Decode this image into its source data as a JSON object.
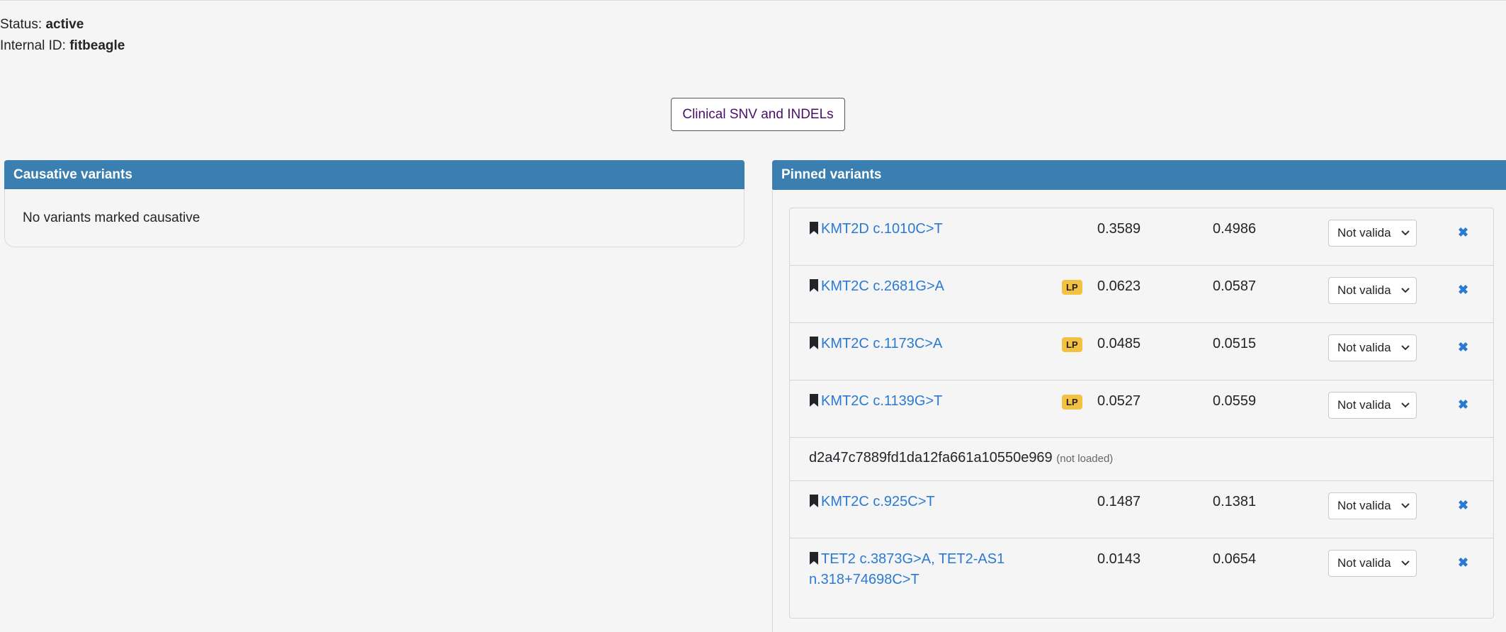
{
  "case_info": {
    "status_label": "Status:",
    "status_value": "active",
    "internal_id_label": "Internal ID:",
    "internal_id_value": "fitbeagle"
  },
  "clinical_button": "Clinical SNV and INDELs",
  "causative": {
    "title": "Causative variants",
    "empty_text": "No variants marked causative"
  },
  "pinned": {
    "title": "Pinned variants",
    "variants": [
      {
        "name": "KMT2D c.1010C>T",
        "badge": "",
        "v1": "0.3589",
        "v2": "0.4986",
        "validation": "Not valida"
      },
      {
        "name": "KMT2C c.2681G>A",
        "badge": "LP",
        "v1": "0.0623",
        "v2": "0.0587",
        "validation": "Not valida"
      },
      {
        "name": "KMT2C c.1173C>A",
        "badge": "LP",
        "v1": "0.0485",
        "v2": "0.0515",
        "validation": "Not valida"
      },
      {
        "name": "KMT2C c.1139G>T",
        "badge": "LP",
        "v1": "0.0527",
        "v2": "0.0559",
        "validation": "Not valida"
      },
      {
        "name": "KMT2C c.925C>T",
        "badge": "",
        "v1": "0.1487",
        "v2": "0.1381",
        "validation": "Not valida"
      },
      {
        "name_line1": "TET2 c.3873G>A, TET2-AS1",
        "name_line2": "n.318+74698C>T",
        "badge": "",
        "v1": "0.0143",
        "v2": "0.0654",
        "validation": "Not valida"
      }
    ],
    "unloaded": {
      "id": "d2a47c7889fd1da12fa661a10550e969",
      "note": "(not loaded)"
    },
    "remove_glyph": "✖"
  },
  "colors": {
    "header": "#3a7fb0",
    "link": "#2a7ad2",
    "badge_lp": "#f3c142"
  }
}
